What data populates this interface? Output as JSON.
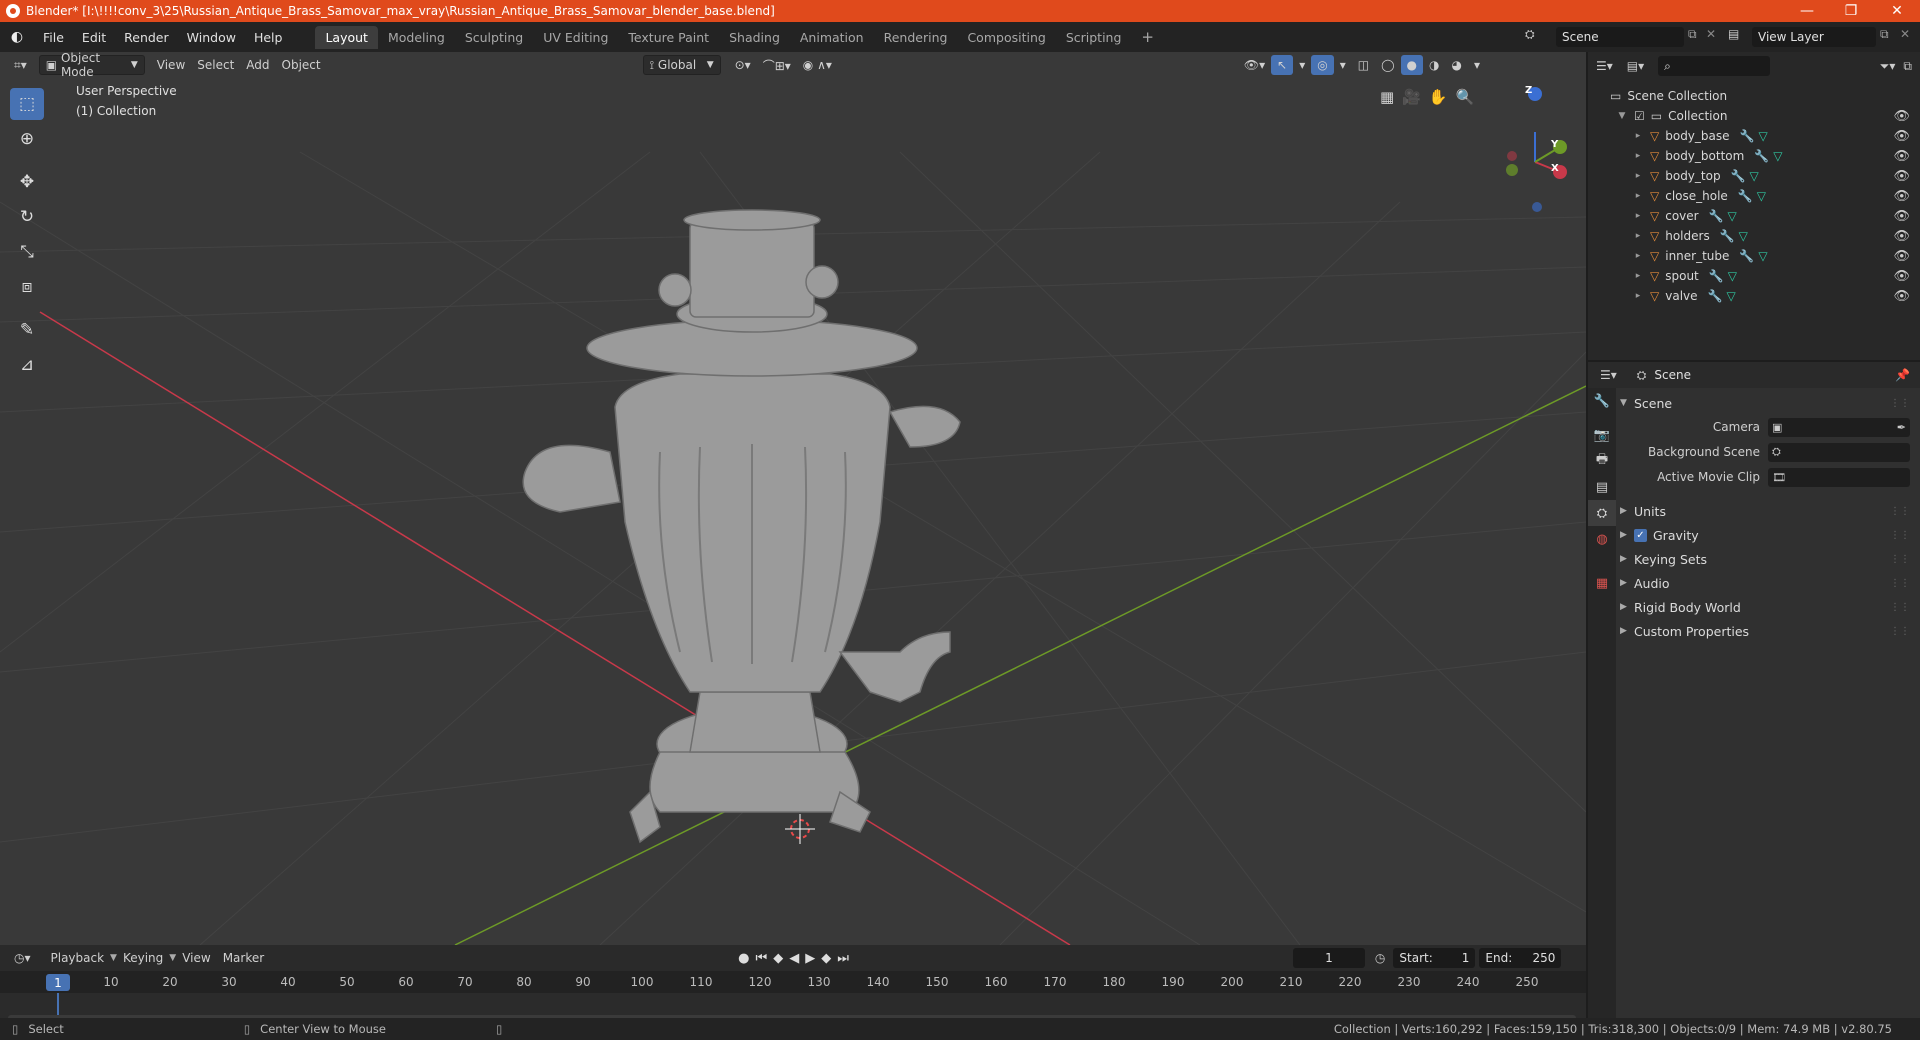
{
  "window": {
    "title": "Blender* [I:\\!!!!conv_3\\25\\Russian_Antique_Brass_Samovar_max_vray\\Russian_Antique_Brass_Samovar_blender_base.blend]",
    "minimize": "—",
    "maximize": "❐",
    "close": "✕"
  },
  "menu": [
    "File",
    "Edit",
    "Render",
    "Window",
    "Help"
  ],
  "workspaces": [
    "Layout",
    "Modeling",
    "Sculpting",
    "UV Editing",
    "Texture Paint",
    "Shading",
    "Animation",
    "Rendering",
    "Compositing",
    "Scripting"
  ],
  "active_workspace": "Layout",
  "scene_selector": "Scene",
  "view_layer_selector": "View Layer",
  "viewport": {
    "mode": "Object Mode",
    "menus": [
      "View",
      "Select",
      "Add",
      "Object"
    ],
    "orientation": "Global",
    "overlay_text": "User Perspective",
    "overlay_sub": "(1) Collection",
    "gizmo_axes": {
      "x": "X",
      "y": "Y",
      "z": "Z"
    }
  },
  "tools": [
    {
      "name": "select-box-tool",
      "icon": "⬚"
    },
    {
      "name": "cursor-tool",
      "icon": "⊕"
    },
    {
      "name": "move-tool",
      "icon": "✥"
    },
    {
      "name": "rotate-tool",
      "icon": "↻"
    },
    {
      "name": "scale-tool",
      "icon": "⤡"
    },
    {
      "name": "transform-tool",
      "icon": "⧈"
    },
    {
      "name": "annotate-tool",
      "icon": "✎"
    },
    {
      "name": "measure-tool",
      "icon": "📐"
    }
  ],
  "timeline": {
    "menus": [
      "Playback",
      "Keying",
      "View",
      "Marker"
    ],
    "current_frame": "1",
    "start_label": "Start:",
    "start": "1",
    "end_label": "End:",
    "end": "250",
    "ticks": [
      "1",
      "10",
      "20",
      "30",
      "40",
      "50",
      "60",
      "70",
      "80",
      "90",
      "100",
      "110",
      "120",
      "130",
      "140",
      "150",
      "160",
      "170",
      "180",
      "190",
      "200",
      "210",
      "220",
      "230",
      "240",
      "250"
    ]
  },
  "outliner": {
    "root": "Scene Collection",
    "collection": "Collection",
    "objects": [
      "body_base",
      "body_bottom",
      "body_top",
      "close_hole",
      "cover",
      "holders",
      "inner_tube",
      "spout",
      "valve"
    ]
  },
  "properties": {
    "header": "Scene",
    "panel": "Scene",
    "rows": [
      {
        "label": "Camera",
        "value": ""
      },
      {
        "label": "Background Scene",
        "value": ""
      },
      {
        "label": "Active Movie Clip",
        "value": ""
      }
    ],
    "sections": [
      "Units",
      "Gravity",
      "Keying Sets",
      "Audio",
      "Rigid Body World",
      "Custom Properties"
    ]
  },
  "statusbar": {
    "left1": "Select",
    "left2": "Center View to Mouse",
    "right": "Collection | Verts:160,292 | Faces:159,150 | Tris:318,300 | Objects:0/9 | Mem: 74.9 MB | v2.80.75"
  },
  "colors": {
    "titlebar": "#e04a1c",
    "accent": "#4772b3",
    "viewport_bg": "#393939",
    "axis_x": "#c8394a",
    "axis_y": "#6d9a27",
    "mesh_icon": "#e08a3a",
    "data_icon": "#2fc6a0"
  }
}
